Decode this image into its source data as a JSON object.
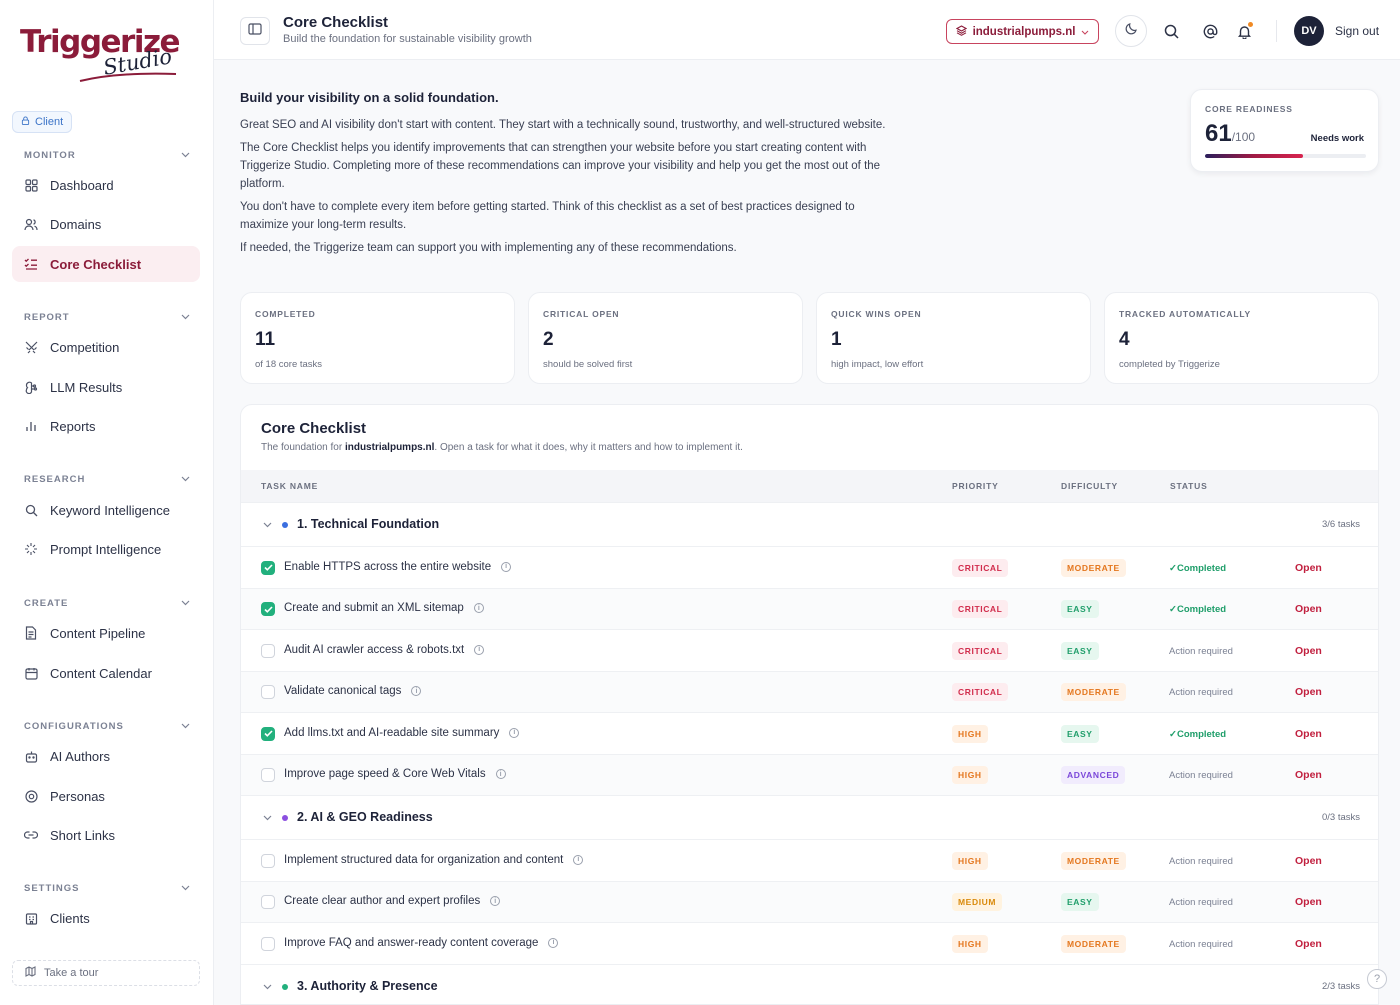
{
  "brand": {
    "logo_main": "Triggerize",
    "logo_sub": "Studio",
    "accent": "#8b1c3a"
  },
  "sidebar": {
    "client_badge": "Client",
    "sections": [
      {
        "label": "MONITOR"
      },
      {
        "label": "REPORT"
      },
      {
        "label": "RESEARCH"
      },
      {
        "label": "CREATE"
      },
      {
        "label": "CONFIGURATIONS"
      },
      {
        "label": "SETTINGS"
      }
    ],
    "items": [
      {
        "label": "Dashboard",
        "icon": "grid-icon"
      },
      {
        "label": "Domains",
        "icon": "users-icon"
      },
      {
        "label": "Core Checklist",
        "icon": "checklist-icon",
        "active": true
      },
      {
        "label": "Competition",
        "icon": "swords-icon"
      },
      {
        "label": "LLM Results",
        "icon": "brain-icon"
      },
      {
        "label": "Reports",
        "icon": "bar-chart-icon"
      },
      {
        "label": "Keyword Intelligence",
        "icon": "search-icon"
      },
      {
        "label": "Prompt Intelligence",
        "icon": "sparkles-icon"
      },
      {
        "label": "Content Pipeline",
        "icon": "document-icon"
      },
      {
        "label": "Content Calendar",
        "icon": "calendar-icon"
      },
      {
        "label": "AI Authors",
        "icon": "robot-icon"
      },
      {
        "label": "Personas",
        "icon": "persona-icon"
      },
      {
        "label": "Short Links",
        "icon": "link-icon"
      },
      {
        "label": "Clients",
        "icon": "building-icon"
      }
    ],
    "tour": "Take a tour"
  },
  "header": {
    "title": "Core Checklist",
    "subtitle": "Build the foundation for sustainable visibility growth",
    "domain": "industrialpumps.nl",
    "avatar": "DV",
    "signout": "Sign out"
  },
  "intro": {
    "title": "Build your visibility on a solid foundation.",
    "p1": "Great SEO and AI visibility don't start with content. They start with a technically sound, trustworthy, and well-structured website.",
    "p2": "The Core Checklist helps you identify improvements that can strengthen your website before you start creating content with Triggerize Studio. Completing more of these recommendations can improve your visibility and help you get the most out of the platform.",
    "p3": "You don't have to complete every item before getting started. Think of this checklist as a set of best practices designed to maximize your long-term results.",
    "p4": "If needed, the Triggerize team can support you with implementing any of these recommendations."
  },
  "readiness": {
    "label": "CORE READINESS",
    "score": "61",
    "max": "/100",
    "status": "Needs work",
    "progress": 0.61
  },
  "stats": [
    {
      "label": "COMPLETED",
      "value": "11",
      "desc": "of 18 core tasks"
    },
    {
      "label": "CRITICAL OPEN",
      "value": "2",
      "desc": "should be solved first"
    },
    {
      "label": "QUICK WINS OPEN",
      "value": "1",
      "desc": "high impact, low effort"
    },
    {
      "label": "TRACKED AUTOMATICALLY",
      "value": "4",
      "desc": "completed by Triggerize"
    }
  ],
  "checklist": {
    "title": "Core Checklist",
    "sub_prefix": "The foundation for",
    "sub_domain": "industrialpumps.nl",
    "sub_suffix": ". Open a task for what it does, why it matters and how to implement it.",
    "columns": {
      "task": "TASK NAME",
      "priority": "PRIORITY",
      "difficulty": "DIFFICULTY",
      "status": "STATUS"
    },
    "open_label": "Open",
    "groups": [
      {
        "name": "1. Technical Foundation",
        "count": "3/6 tasks",
        "color": "#3b6fe0",
        "tasks": [
          {
            "name": "Enable HTTPS across the entire website",
            "priority": "CRITICAL",
            "difficulty": "MODERATE",
            "status": "✓Completed",
            "done": true
          },
          {
            "name": "Create and submit an XML sitemap",
            "priority": "CRITICAL",
            "difficulty": "EASY",
            "status": "✓Completed",
            "done": true
          },
          {
            "name": "Audit AI crawler access & robots.txt",
            "priority": "CRITICAL",
            "difficulty": "EASY",
            "status": "Action required",
            "done": false
          },
          {
            "name": "Validate canonical tags",
            "priority": "CRITICAL",
            "difficulty": "MODERATE",
            "status": "Action required",
            "done": false
          },
          {
            "name": "Add llms.txt and AI-readable site summary",
            "priority": "HIGH",
            "difficulty": "EASY",
            "status": "✓Completed",
            "done": true
          },
          {
            "name": "Improve page speed & Core Web Vitals",
            "priority": "HIGH",
            "difficulty": "ADVANCED",
            "status": "Action required",
            "done": false
          }
        ]
      },
      {
        "name": "2. AI & GEO Readiness",
        "count": "0/3 tasks",
        "color": "#8b4fe0",
        "tasks": [
          {
            "name": "Implement structured data for organization and content",
            "priority": "HIGH",
            "difficulty": "MODERATE",
            "status": "Action required",
            "done": false
          },
          {
            "name": "Create clear author and expert profiles",
            "priority": "MEDIUM",
            "difficulty": "EASY",
            "status": "Action required",
            "done": false
          },
          {
            "name": "Improve FAQ and answer-ready content coverage",
            "priority": "HIGH",
            "difficulty": "MODERATE",
            "status": "Action required",
            "done": false
          }
        ]
      },
      {
        "name": "3. Authority & Presence",
        "count": "2/3 tasks",
        "color": "#22b07d",
        "tasks": []
      }
    ]
  }
}
